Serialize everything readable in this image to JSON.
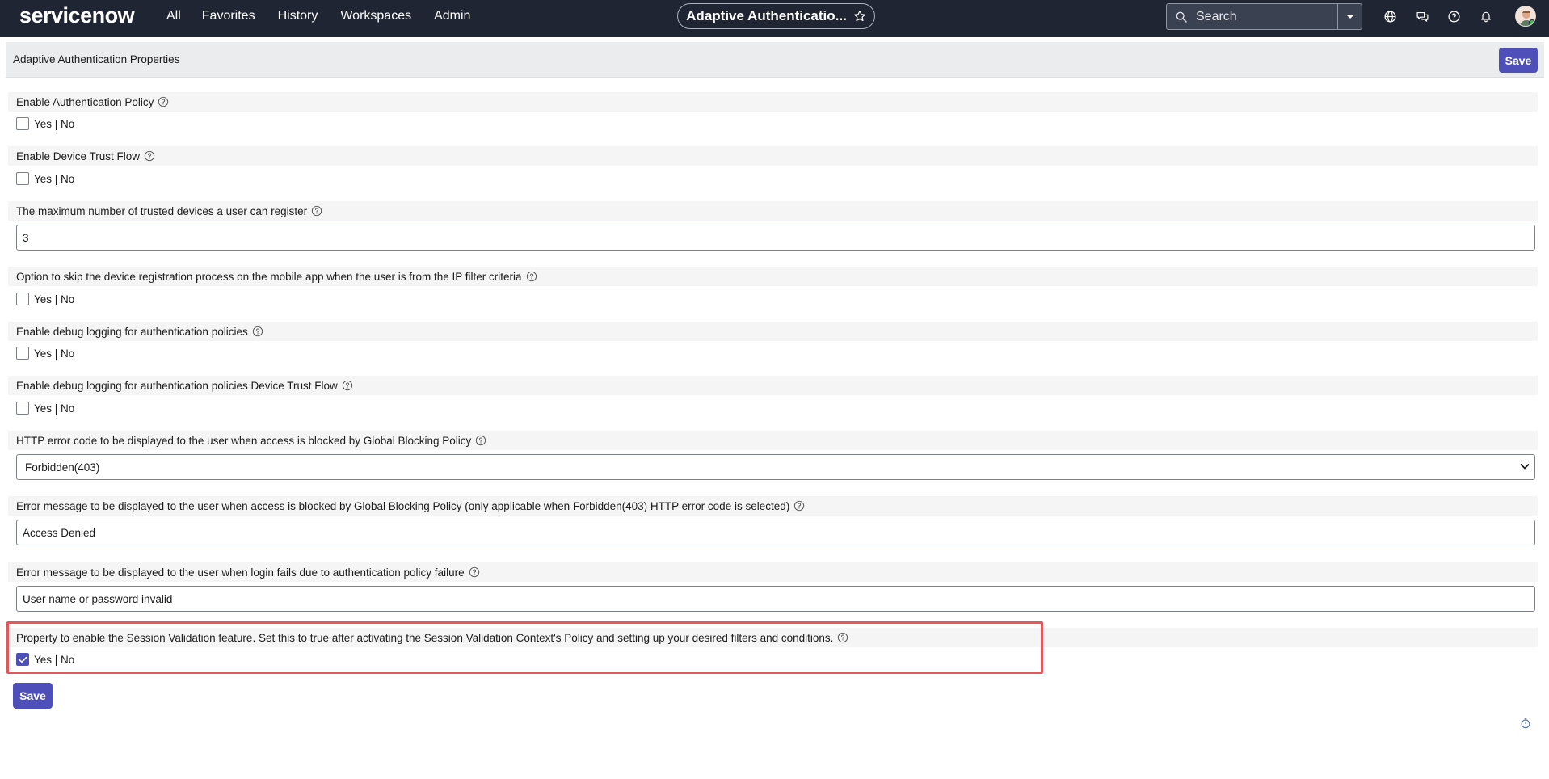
{
  "nav": {
    "logo": "servicenow",
    "menu": [
      "All",
      "Favorites",
      "History",
      "Workspaces",
      "Admin"
    ],
    "context_title": "Adaptive Authenticatio...",
    "search_placeholder": "Search",
    "icons": [
      "globe-icon",
      "chat-icon",
      "help-icon",
      "bell-icon",
      "avatar"
    ]
  },
  "header": {
    "title": "Adaptive Authentication Properties",
    "save_label": "Save"
  },
  "properties": [
    {
      "label": "Enable Authentication Policy",
      "type": "checkbox",
      "checked": false,
      "option_text": "Yes | No"
    },
    {
      "label": "Enable Device Trust Flow",
      "type": "checkbox",
      "checked": false,
      "option_text": "Yes | No"
    },
    {
      "label": "The maximum number of trusted devices a user can register",
      "type": "text",
      "value": "3"
    },
    {
      "label": "Option to skip the device registration process on the mobile app when the user is from the IP filter criteria",
      "type": "checkbox",
      "checked": false,
      "option_text": "Yes | No"
    },
    {
      "label": "Enable debug logging for authentication policies",
      "type": "checkbox",
      "checked": false,
      "option_text": "Yes | No"
    },
    {
      "label": "Enable debug logging for authentication policies Device Trust Flow",
      "type": "checkbox",
      "checked": false,
      "option_text": "Yes | No"
    },
    {
      "label": "HTTP error code to be displayed to the user when access is blocked by Global Blocking Policy",
      "type": "select",
      "value": "Forbidden(403)"
    },
    {
      "label": "Error message to be displayed to the user when access is blocked by Global Blocking Policy (only applicable when Forbidden(403) HTTP error code is selected)",
      "type": "text",
      "value": "Access Denied"
    },
    {
      "label": "Error message to be displayed to the user when login fails due to authentication policy failure",
      "type": "text",
      "value": "User name or password invalid"
    },
    {
      "label": "Property to enable the Session Validation feature. Set this to true after activating the Session Validation Context's Policy and setting up your desired filters and conditions.",
      "type": "checkbox",
      "checked": true,
      "option_text": "Yes | No"
    }
  ],
  "footer": {
    "save_label": "Save"
  },
  "colors": {
    "nav_bg": "#1f2532",
    "button": "#4e4fb8",
    "highlight": "#e2585b"
  }
}
